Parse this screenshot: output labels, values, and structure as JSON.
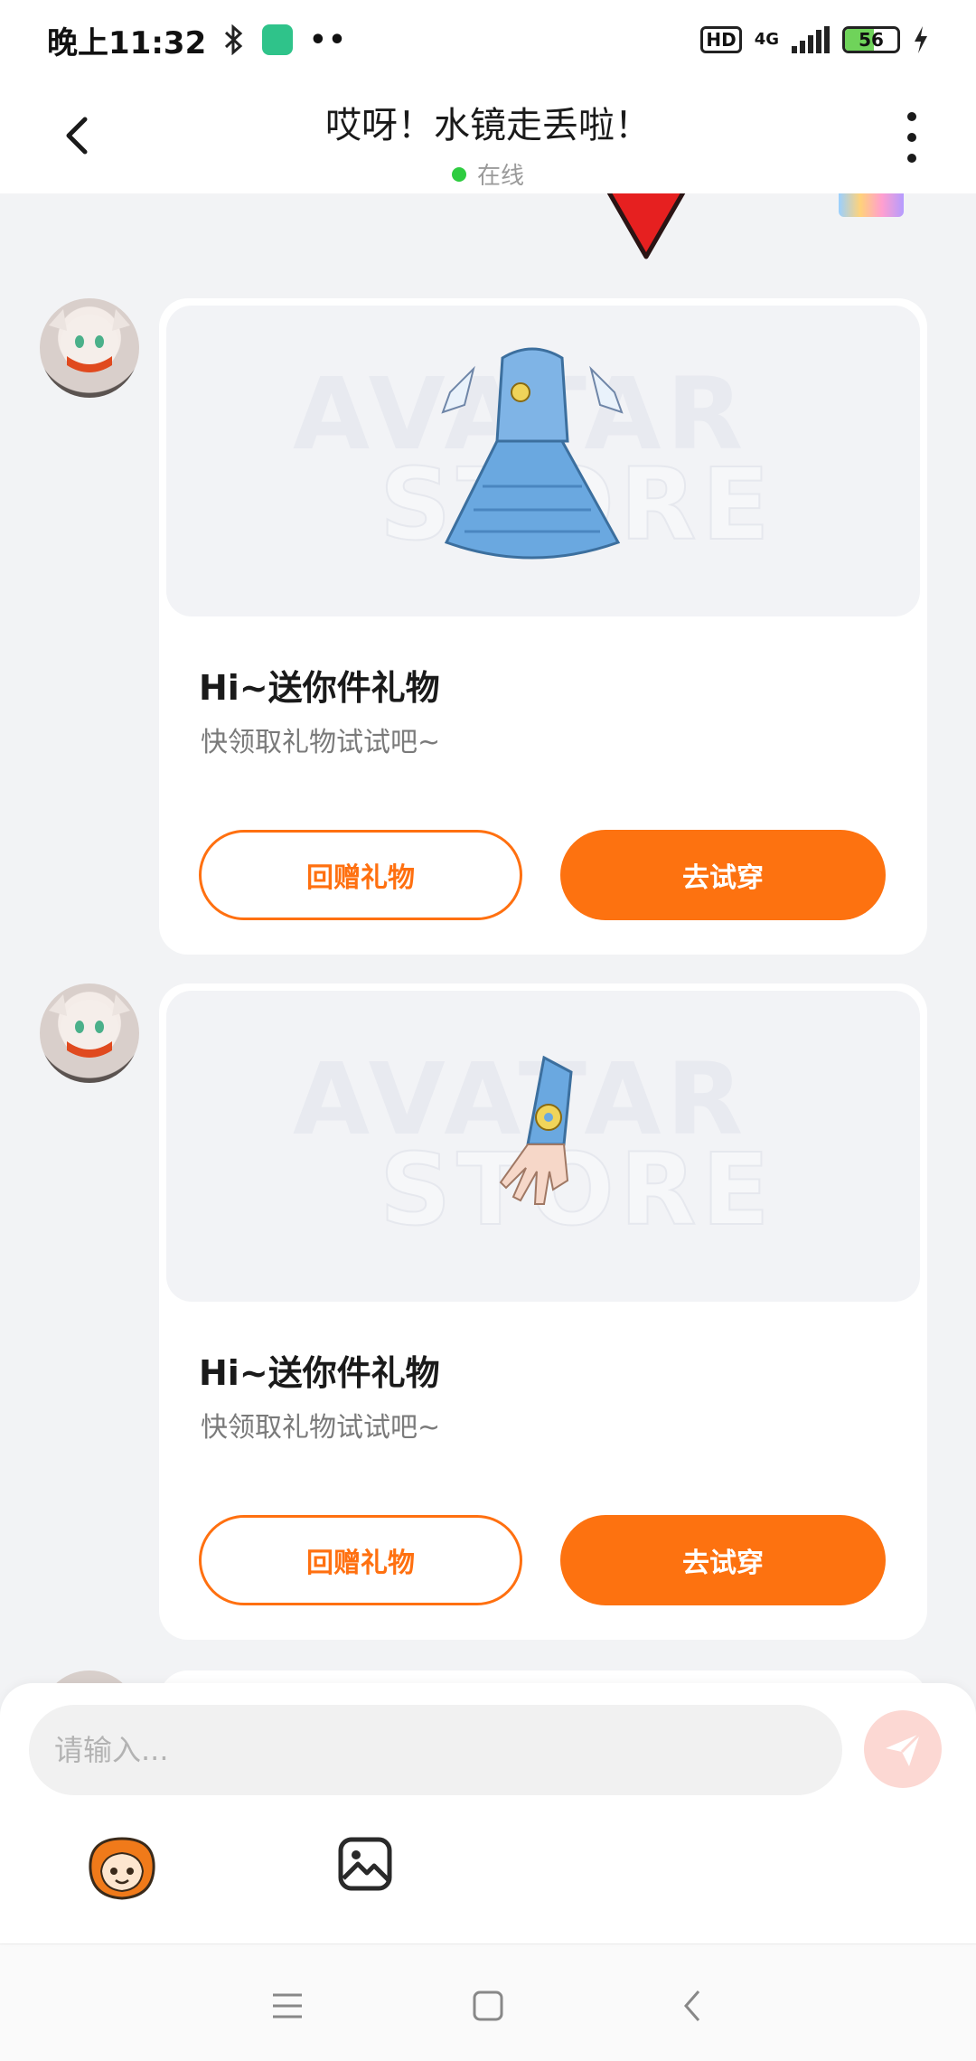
{
  "status_bar": {
    "time": "晚上11:32",
    "network_type": "4G",
    "battery_level": "56",
    "hd_label": "HD"
  },
  "header": {
    "title": "哎呀！水镜走丢啦！",
    "status": "在线"
  },
  "messages": [
    {
      "card_title": "Hi~送你件礼物",
      "card_subtitle": "快领取礼物试试吧~",
      "return_gift_label": "回赠礼物",
      "try_on_label": "去试穿",
      "item": "dress-icon"
    },
    {
      "card_title": "Hi~送你件礼物",
      "card_subtitle": "快领取礼物试试吧~",
      "return_gift_label": "回赠礼物",
      "try_on_label": "去试穿",
      "item": "glove-icon"
    }
  ],
  "input": {
    "placeholder": "请输入..."
  },
  "colors": {
    "accent": "#fd7210",
    "online": "#2ecc40",
    "send_disabled": "#fcd8d3"
  }
}
